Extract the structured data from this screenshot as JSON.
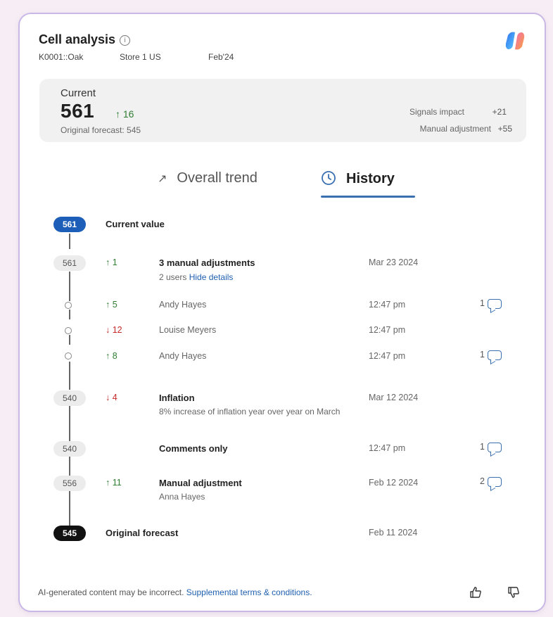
{
  "header": {
    "title": "Cell analysis",
    "sku": "K0001::Oak",
    "store": "Store 1 US",
    "period": "Feb'24"
  },
  "summary": {
    "current_label": "Current",
    "current_value": "561",
    "delta": "16",
    "original_forecast": "Original forecast: 545",
    "signals_label": "Signals impact",
    "signals_value": "+21",
    "manual_label": "Manual adjustment",
    "manual_value": "+55"
  },
  "tabs": [
    {
      "label": "Overall trend",
      "icon": "trend-arrow-icon",
      "active": false
    },
    {
      "label": "History",
      "icon": "clock-icon",
      "active": true
    }
  ],
  "history": {
    "current": {
      "badge": "561",
      "label": "Current value"
    },
    "adjust3": {
      "badge": "561",
      "delta": "1",
      "title": "3 manual adjustments",
      "users": "2 users",
      "hide": "Hide details",
      "date": "Mar 23 2024"
    },
    "sub1": {
      "delta": "5",
      "user": "Andy Hayes",
      "time": "12:47 pm",
      "comments": "1"
    },
    "sub2": {
      "delta": "12",
      "user": "Louise Meyers",
      "time": "12:47 pm"
    },
    "sub3": {
      "delta": "8",
      "user": "Andy Hayes",
      "time": "12:47 pm",
      "comments": "1"
    },
    "inflation": {
      "badge": "540",
      "delta": "4",
      "title": "Inflation",
      "desc": "8% increase of inflation year over year on March",
      "date": "Mar 12 2024"
    },
    "comments_only": {
      "badge": "540",
      "title": "Comments only",
      "time": "12:47 pm",
      "comments": "1"
    },
    "manual": {
      "badge": "556",
      "delta": "11",
      "title": "Manual adjustment",
      "user": "Anna Hayes",
      "date": "Feb 12 2024",
      "comments": "2"
    },
    "original": {
      "badge": "545",
      "label": "Original forecast",
      "date": "Feb 11 2024"
    }
  },
  "footer": {
    "disclaimer": "AI-generated content may be incorrect.",
    "terms_link": "Supplemental terms & conditions."
  },
  "colors": {
    "accent": "#1d5fb8",
    "up": "#2f7d32",
    "down": "#c62828"
  }
}
